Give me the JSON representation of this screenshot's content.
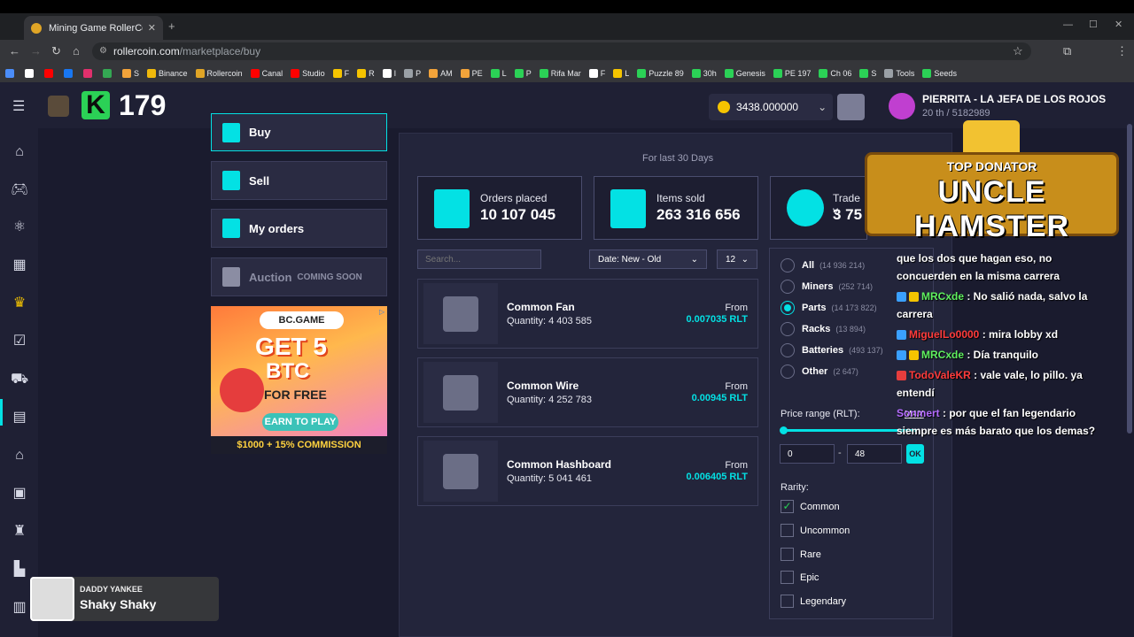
{
  "browser": {
    "tab_title": "Mining Game RollerCoin: Play I",
    "url_host": "rollercoin.com",
    "url_path": "/marketplace/buy",
    "bookmarks": [
      {
        "label": "S",
        "color": "#f2a33a"
      },
      {
        "label": "Binance",
        "color": "#f0b90b"
      },
      {
        "label": "Rollercoin",
        "color": "#e0a526"
      },
      {
        "label": "Canal",
        "color": "#ff0000"
      },
      {
        "label": "Studio",
        "color": "#ff0000"
      },
      {
        "label": "F",
        "color": "#f5c400"
      },
      {
        "label": "R",
        "color": "#f5c400"
      },
      {
        "label": "I",
        "color": "#ffffff"
      },
      {
        "label": "P",
        "color": "#9aa0a6"
      },
      {
        "label": "AM",
        "color": "#f2a33a"
      },
      {
        "label": "PE",
        "color": "#f2a33a"
      },
      {
        "label": "L",
        "color": "#2bd156"
      },
      {
        "label": "P",
        "color": "#2bd156"
      },
      {
        "label": "Rifa Mar",
        "color": "#2bd156"
      },
      {
        "label": "F",
        "color": "#ffffff"
      },
      {
        "label": "L",
        "color": "#f5c400"
      },
      {
        "label": "Puzzle 89",
        "color": "#2bd156"
      },
      {
        "label": "30h",
        "color": "#2bd156"
      },
      {
        "label": "Genesis",
        "color": "#2bd156"
      },
      {
        "label": "PE 197",
        "color": "#2bd156"
      },
      {
        "label": "Ch 06",
        "color": "#2bd156"
      },
      {
        "label": "S",
        "color": "#2bd156"
      },
      {
        "label": "Tools",
        "color": "#9aa0a6"
      },
      {
        "label": "Seeds",
        "color": "#2bd156"
      }
    ]
  },
  "header": {
    "level_letter": "K",
    "level_value": "179",
    "balance": "3438.000000",
    "user_name": "PIERRITA - LA JEFA DE LOS ROJOS",
    "user_rank": "20 th / 5182989"
  },
  "sidebar_icons": [
    "home-icon",
    "gamepad-icon",
    "rank-icon",
    "calendar-icon",
    "crown-icon",
    "tasks-icon",
    "cart-icon",
    "marketplace-icon",
    "bank-icon",
    "gift-icon",
    "trophy-icon",
    "factory-icon",
    "news-icon"
  ],
  "menu": {
    "buy": "Buy",
    "sell": "Sell",
    "my_orders": "My orders",
    "auction": "Auction",
    "coming_soon": "COMING SOON"
  },
  "ad": {
    "logo": "BC.GAME",
    "headline": "GET 5",
    "headline2": "BTC",
    "sub": "FOR FREE",
    "cta": "EARN TO PLAY",
    "commission": "$1000 + 15% COMMISSION"
  },
  "stats": {
    "period": "For last 30 Days",
    "orders_label": "Orders placed",
    "orders_value": "10 107 045",
    "items_label": "Items sold",
    "items_value": "263 316 656",
    "trade_label": "Trade v",
    "trade_value": "3 75"
  },
  "controls": {
    "search_placeholder": "Search...",
    "sort": "Date: New - Old",
    "per_page": "12"
  },
  "items": [
    {
      "name": "Common Fan",
      "qty": "Quantity: 4 403 585",
      "from": "From",
      "price": "0.007035 RLT"
    },
    {
      "name": "Common Wire",
      "qty": "Quantity: 4 252 783",
      "from": "From",
      "price": "0.00945 RLT"
    },
    {
      "name": "Common Hashboard",
      "qty": "Quantity: 5 041 461",
      "from": "From",
      "price": "0.006405 RLT"
    }
  ],
  "filters": {
    "categories": [
      {
        "label": "All",
        "count": "(14 936 214)",
        "selected": false
      },
      {
        "label": "Miners",
        "count": "(252 714)",
        "selected": false
      },
      {
        "label": "Parts",
        "count": "(14 173 822)",
        "selected": true
      },
      {
        "label": "Racks",
        "count": "(13 894)",
        "selected": false
      },
      {
        "label": "Batteries",
        "count": "(493 137)",
        "selected": false
      },
      {
        "label": "Other",
        "count": "(2 647)",
        "selected": false
      }
    ],
    "price_label": "Price range (RLT):",
    "max_label": "MAX",
    "price_min": "0",
    "price_max": "48",
    "dash": "-",
    "ok": "OK",
    "rarity_label": "Rarity:",
    "rarities": [
      {
        "label": "Common",
        "checked": true
      },
      {
        "label": "Uncommon",
        "checked": false
      },
      {
        "label": "Rare",
        "checked": false
      },
      {
        "label": "Epic",
        "checked": false
      },
      {
        "label": "Legendary",
        "checked": false
      }
    ]
  },
  "overlay": {
    "donator_top": "TOP DONATOR",
    "donator_name": "UNCLE HAMSTER",
    "chat": [
      {
        "user": "",
        "text": "que los dos que hagan eso, no concuerden en la misma carrera",
        "color": ""
      },
      {
        "user": "MRCxde",
        "text": " : No salió nada, salvo la carrera",
        "color": "green"
      },
      {
        "user": "MiguelLo0000",
        "text": " : mira lobby xd",
        "color": "red"
      },
      {
        "user": "MRCxde",
        "text": " : Día tranquilo",
        "color": "green"
      },
      {
        "user": "TodoValeKR",
        "text": " : vale vale, lo pillo. ya entendí",
        "color": "red"
      },
      {
        "user": "Sonmert",
        "text": " : por que el fan legendario siempre es más barato que los demas?",
        "color": "purple"
      }
    ],
    "now_playing_artist": "DADDY YANKEE",
    "now_playing_song": "Shaky Shaky"
  }
}
